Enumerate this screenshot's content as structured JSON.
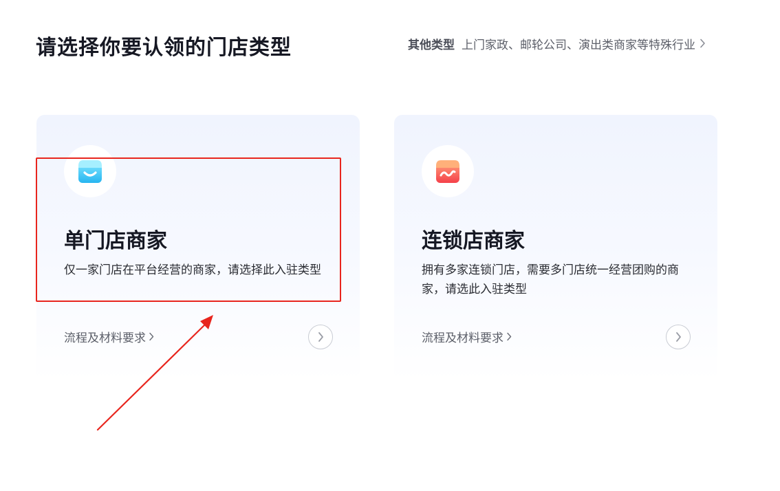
{
  "page_title": "请选择你要认领的门店类型",
  "other_types": {
    "label": "其他类型",
    "description": "上门家政、邮轮公司、演出类商家等特殊行业",
    "icon": "chevron-right-icon"
  },
  "cards": [
    {
      "title": "单门店商家",
      "description": "仅一家门店在平台经营的商家，请选择此入驻类型",
      "link_label": "流程及材料要求",
      "icon": "shop-blue-icon",
      "icon_color": "#3ec9f5"
    },
    {
      "title": "连锁店商家",
      "description": "拥有多家连锁门店，需要多门店统一经营团购的商家，请选此入驻类型",
      "link_label": "流程及材料要求",
      "icon": "shop-red-icon",
      "icon_color": "#fa5a53"
    }
  ],
  "colors": {
    "annotation_red": "#e8251d",
    "title": "#161823",
    "card_bg": "#f0f4fe"
  }
}
